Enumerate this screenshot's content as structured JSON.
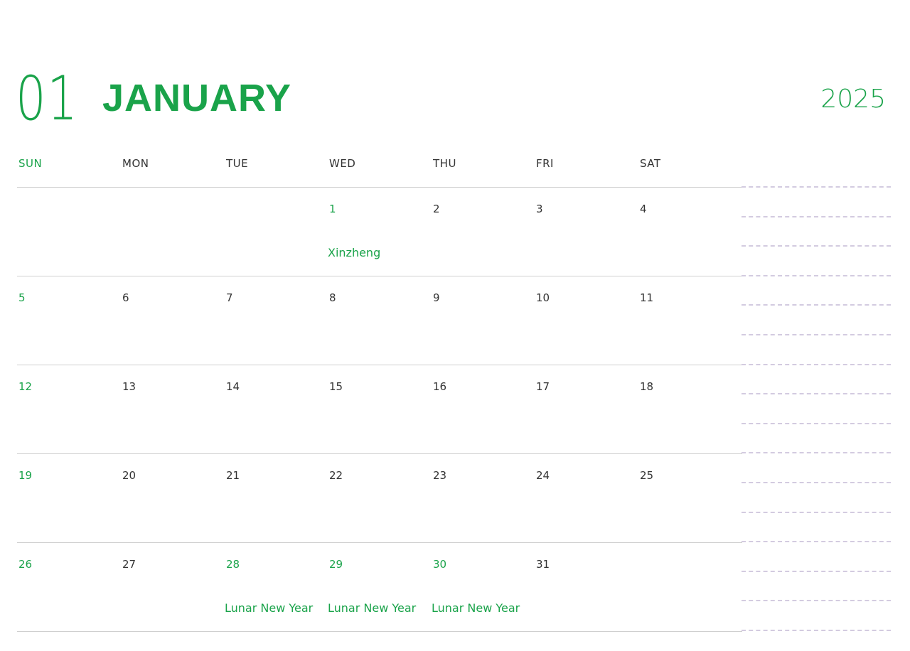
{
  "header": {
    "month_number": "01",
    "month_name": "JANUARY",
    "year": "2025"
  },
  "weekdays": [
    "SUN",
    "MON",
    "TUE",
    "WED",
    "THU",
    "FRI",
    "SAT"
  ],
  "weeks": [
    [
      {
        "day": "",
        "note": ""
      },
      {
        "day": "",
        "note": ""
      },
      {
        "day": "",
        "note": ""
      },
      {
        "day": "1",
        "note": "Xinzheng",
        "highlight": true
      },
      {
        "day": "2",
        "note": ""
      },
      {
        "day": "3",
        "note": ""
      },
      {
        "day": "4",
        "note": ""
      }
    ],
    [
      {
        "day": "5",
        "note": "",
        "highlight": true
      },
      {
        "day": "6",
        "note": ""
      },
      {
        "day": "7",
        "note": ""
      },
      {
        "day": "8",
        "note": ""
      },
      {
        "day": "9",
        "note": ""
      },
      {
        "day": "10",
        "note": ""
      },
      {
        "day": "11",
        "note": ""
      }
    ],
    [
      {
        "day": "12",
        "note": "",
        "highlight": true
      },
      {
        "day": "13",
        "note": ""
      },
      {
        "day": "14",
        "note": ""
      },
      {
        "day": "15",
        "note": ""
      },
      {
        "day": "16",
        "note": ""
      },
      {
        "day": "17",
        "note": ""
      },
      {
        "day": "18",
        "note": ""
      }
    ],
    [
      {
        "day": "19",
        "note": "",
        "highlight": true
      },
      {
        "day": "20",
        "note": ""
      },
      {
        "day": "21",
        "note": ""
      },
      {
        "day": "22",
        "note": ""
      },
      {
        "day": "23",
        "note": ""
      },
      {
        "day": "24",
        "note": ""
      },
      {
        "day": "25",
        "note": ""
      }
    ],
    [
      {
        "day": "26",
        "note": "",
        "highlight": true
      },
      {
        "day": "27",
        "note": ""
      },
      {
        "day": "28",
        "note": "Lunar New Year",
        "highlight": true
      },
      {
        "day": "29",
        "note": "Lunar New Year",
        "highlight": true
      },
      {
        "day": "30",
        "note": "Lunar New Year",
        "highlight": true
      },
      {
        "day": "31",
        "note": ""
      },
      {
        "day": "",
        "note": ""
      }
    ]
  ],
  "colors": {
    "accent": "#1aa34a",
    "text": "#333333",
    "rule": "#cfcfcf",
    "dashed_rule": "#d3cbe0"
  }
}
